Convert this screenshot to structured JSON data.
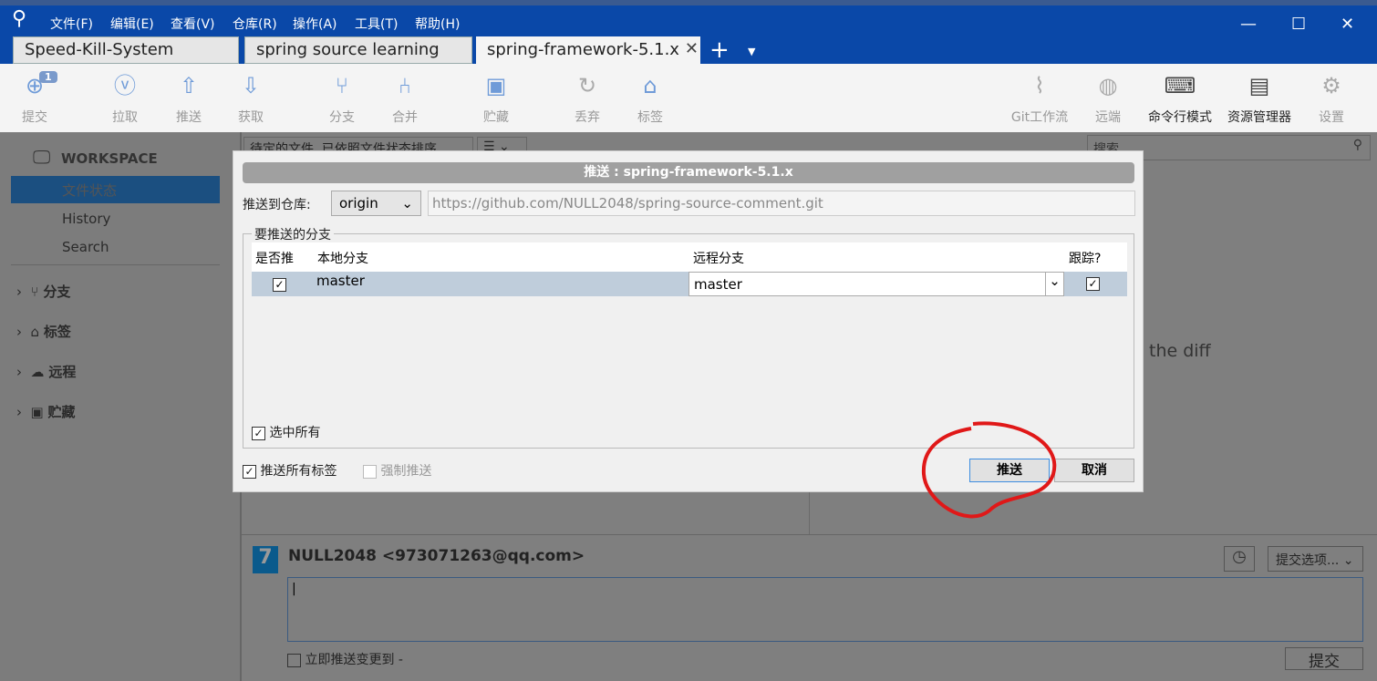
{
  "menu": [
    "文件(F)",
    "编辑(E)",
    "查看(V)",
    "仓库(R)",
    "操作(A)",
    "工具(T)",
    "帮助(H)"
  ],
  "tabs": [
    {
      "label": "Speed-Kill-System"
    },
    {
      "label": "spring source learning"
    },
    {
      "label": "spring-framework-5.1.x",
      "active": true
    }
  ],
  "toolbar": {
    "left": [
      {
        "label": "提交",
        "icon": "plus-circle-icon",
        "badge": "1"
      },
      {
        "label": "拉取",
        "icon": "arrow-down-circle-icon"
      },
      {
        "label": "推送",
        "icon": "arrow-up-circle-icon"
      },
      {
        "label": "获取",
        "icon": "fetch-icon"
      },
      {
        "label": "分支",
        "icon": "branch-icon"
      },
      {
        "label": "合并",
        "icon": "merge-icon"
      },
      {
        "label": "贮藏",
        "icon": "stash-icon"
      },
      {
        "label": "丢弃",
        "icon": "discard-icon"
      },
      {
        "label": "标签",
        "icon": "tag-icon"
      }
    ],
    "right": [
      {
        "label": "Git工作流",
        "icon": "git-flow-icon"
      },
      {
        "label": "远端",
        "icon": "globe-icon"
      },
      {
        "label": "命令行模式",
        "icon": "terminal-icon"
      },
      {
        "label": "资源管理器",
        "icon": "folder-icon"
      },
      {
        "label": "设置",
        "icon": "gear-icon"
      }
    ]
  },
  "sidebar": {
    "workspace": "WORKSPACE",
    "items": [
      "文件状态",
      "History",
      "Search"
    ],
    "groups": [
      "分支",
      "标签",
      "远程",
      "贮藏"
    ]
  },
  "main": {
    "filter": "待定的文件, 已依照文件状态排序",
    "search_placeholder": "搜索",
    "diff_hint": "the diff",
    "author": "NULL2048 <973071263@qq.com>",
    "avatar_letter": "7",
    "commit_options": "提交选项...",
    "push_immediately": "立即推送变更到 -",
    "commit_button": "提交"
  },
  "dialog": {
    "title": "推送 : spring-framework-5.1.x",
    "repo_label": "推送到仓库:",
    "repo_value": "origin",
    "repo_url": "https://github.com/NULL2048/spring-source-comment.git",
    "group_label": "要推送的分支",
    "columns": [
      "是否推",
      "本地分支",
      "远程分支",
      "跟踪?"
    ],
    "rows": [
      {
        "push": true,
        "local": "master",
        "remote": "master",
        "track": true
      }
    ],
    "select_all": "选中所有",
    "push_all_tags": "推送所有标签",
    "force_push": "强制推送",
    "push_button": "推送",
    "cancel_button": "取消"
  },
  "colors": {
    "titlebar": "#0a48a8",
    "annotation": "#e01818"
  }
}
